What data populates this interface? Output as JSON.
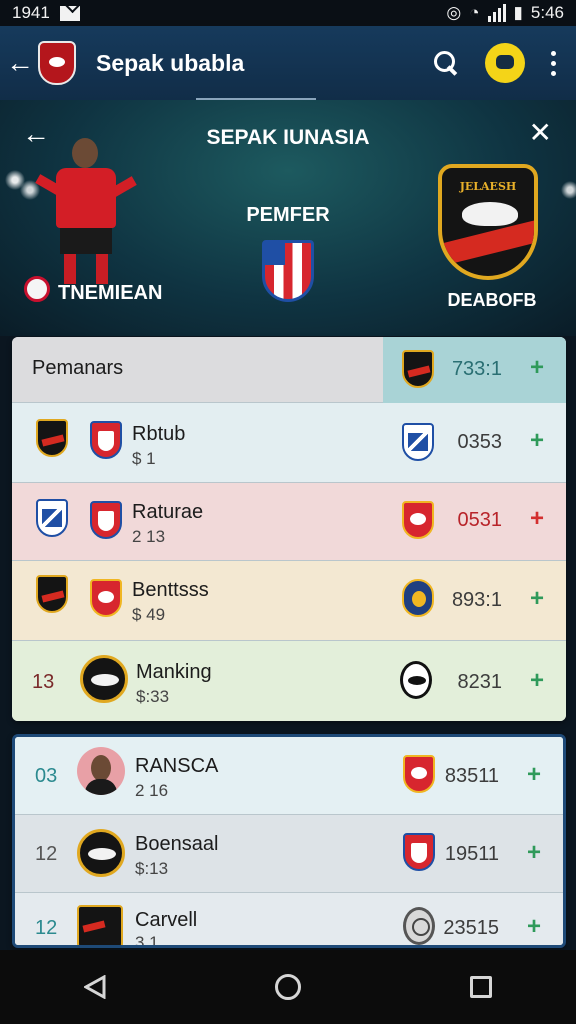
{
  "status_bar": {
    "time_left": "1941",
    "time_right": "5:46"
  },
  "app_bar": {
    "title": "Sepak ubabla"
  },
  "hero": {
    "title": "SEPAK IUNASIA",
    "left_label": "TNEMIEAN",
    "mid_label": "PEMFER",
    "right_label": "DEABOFB",
    "crest_text": "JELAESH"
  },
  "list_header": {
    "label": "Pemanars",
    "value": "733:1",
    "plus": "+"
  },
  "rows_primary": [
    {
      "name": "Rbtub",
      "sub": "$ 1",
      "value": "0353",
      "plus": "+",
      "bg": "#e3eef1",
      "plus_color": "#2f9a5a",
      "value_color": "#3c3c3c"
    },
    {
      "name": "Raturae",
      "sub": "2 13",
      "value": "0531",
      "plus": "+",
      "bg": "#f1d9d9",
      "plus_color": "#d32f2f",
      "value_color": "#b8242a"
    },
    {
      "name": "Benttsss",
      "sub": "$ 49",
      "value": "893:1",
      "plus": "+",
      "bg": "#f3e8d2",
      "plus_color": "#2f9a5a",
      "value_color": "#3c3c3c"
    },
    {
      "num": "13",
      "name": "Manking",
      "sub": "$:33",
      "value": "8231",
      "plus": "+",
      "bg": "#e3efda",
      "plus_color": "#2f9a5a",
      "value_color": "#3c3c3c"
    }
  ],
  "rows_secondary": [
    {
      "num": "03",
      "name": "RANSCA",
      "sub": "2 16",
      "value": "83511",
      "plus": "+",
      "bg": "#e4f0f3",
      "num_color": "#2b8a8f"
    },
    {
      "num": "12",
      "name": "Boensaal",
      "sub": "$:13",
      "value": "19511",
      "plus": "+",
      "bg": "#dde3e7",
      "num_color": "#555"
    },
    {
      "num": "12",
      "name": "Carvell",
      "sub": "3 1",
      "value": "23515",
      "plus": "+",
      "bg": "#e4eaee",
      "num_color": "#2b8a8f"
    }
  ],
  "colors": {
    "accent_green": "#2f9a5a",
    "accent_red": "#d32f2f",
    "app_bar": "#163a5c"
  }
}
